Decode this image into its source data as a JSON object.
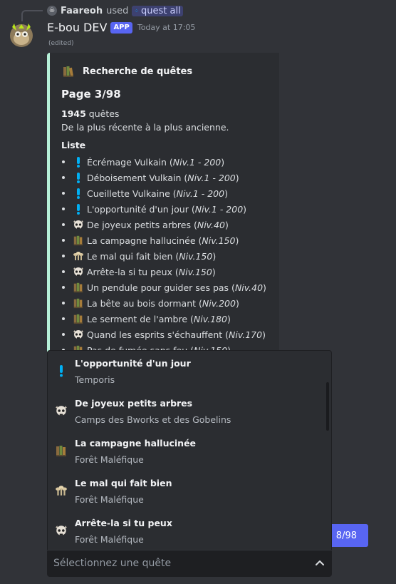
{
  "reply": {
    "user": "Faareoh",
    "used_text": "used",
    "command": "quest all"
  },
  "message": {
    "bot_name": "E-bou DEV",
    "badge": "APP",
    "timestamp": "Today at 17:05",
    "edited": "(edited)"
  },
  "embed": {
    "accent_color": "#b6f0d8",
    "author": "Recherche de quêtes",
    "title": "Page 3/98",
    "count": "1945",
    "count_suffix": " quêtes",
    "order": "De la plus récente à la plus ancienne.",
    "list_label": "Liste",
    "quests": [
      {
        "icon": "exclamation-icon",
        "name": "Écrémage Vulkain",
        "level": "Niv.1 - 200"
      },
      {
        "icon": "exclamation-icon",
        "name": "Déboisement Vulkain",
        "level": "Niv.1 - 200"
      },
      {
        "icon": "exclamation-icon",
        "name": "Cueillette Vulkaine",
        "level": "Niv.1 - 200"
      },
      {
        "icon": "exclamation-icon",
        "name": "L'opportunité d'un jour",
        "level": "Niv.1 - 200"
      },
      {
        "icon": "skull-icon",
        "name": "De joyeux petits arbres",
        "level": "Niv.40"
      },
      {
        "icon": "books-icon",
        "name": "La campagne hallucinée",
        "level": "Niv.150"
      },
      {
        "icon": "mushrooms-icon",
        "name": "Le mal qui fait bien",
        "level": "Niv.150"
      },
      {
        "icon": "skull-icon",
        "name": "Arrête-la si tu peux",
        "level": "Niv.150"
      },
      {
        "icon": "books-icon",
        "name": "Un pendule pour guider ses pas",
        "level": "Niv.40"
      },
      {
        "icon": "books-icon",
        "name": "La bête au bois dormant",
        "level": "Niv.200"
      },
      {
        "icon": "books-icon",
        "name": "Le serment de l'ambre",
        "level": "Niv.180"
      },
      {
        "icon": "skull-icon",
        "name": "Quand les esprits s'échauffent",
        "level": "Niv.170"
      },
      {
        "icon": "books-icon",
        "name": "Pas de fumée sans feu",
        "level": "Niv.150"
      }
    ]
  },
  "pagination": {
    "page_label": "8/98"
  },
  "select_menu": {
    "placeholder": "Sélectionnez une quête",
    "options": [
      {
        "icon": "exclamation-icon",
        "title": "L'opportunité d'un jour",
        "description": "Temporis"
      },
      {
        "icon": "skull-icon",
        "title": "De joyeux petits arbres",
        "description": "Camps des Bworks et des Gobelins"
      },
      {
        "icon": "books-icon",
        "title": "La campagne hallucinée",
        "description": "Forêt Maléfique"
      },
      {
        "icon": "mushrooms-icon",
        "title": "Le mal qui fait bien",
        "description": "Forêt Maléfique"
      },
      {
        "icon": "skull-icon",
        "title": "Arrête-la si tu peux",
        "description": "Forêt Maléfique"
      }
    ]
  },
  "colors": {
    "background": "#313338",
    "embed_background": "#2b2d31",
    "blurple": "#5865f2",
    "exclamation": "#00b0f4"
  }
}
